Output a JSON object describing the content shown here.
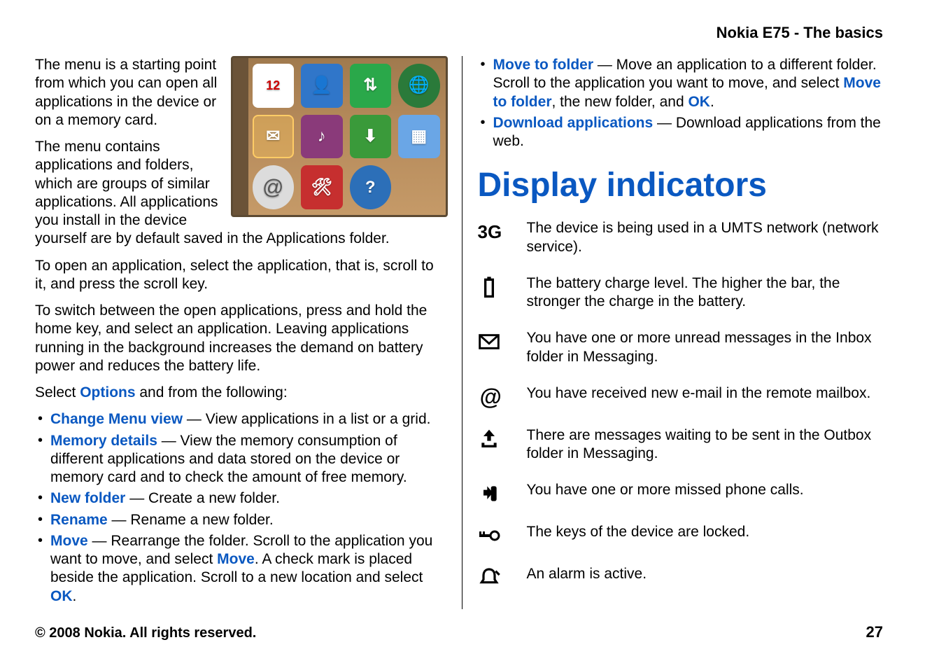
{
  "header": {
    "title": "Nokia E75 - The basics"
  },
  "left": {
    "p1": "The menu is a starting point from which you can open all applications in the device or on a memory card.",
    "p2": "The menu contains applications and folders, which are groups of similar applications. All applications you install in the device yourself are by default saved in the Applications folder.",
    "p3": "To open an application, select the application, that is, scroll to it, and press the scroll key.",
    "p4": "To switch between the open applications, press and hold the home key, and select an application. Leaving applications running in the background increases the demand on battery power and reduces the battery life.",
    "select_prefix": "Select ",
    "options_word": "Options",
    "select_suffix": " and from the following:",
    "opts": {
      "change_menu_view": {
        "label": "Change Menu view",
        "desc": " — View applications in a list or a grid."
      },
      "memory_details": {
        "label": "Memory details",
        "desc": " — View the memory consumption of different applications and data stored on the device or memory card and to check the amount of free memory."
      },
      "new_folder": {
        "label": "New folder",
        "desc": " — Create a new folder."
      },
      "rename": {
        "label": "Rename",
        "desc": " — Rename a new folder."
      },
      "move": {
        "label": "Move",
        "desc1": " — Rearrange the folder. Scroll to the application you want to move, and select ",
        "move_word": "Move",
        "desc2": ". A check mark is placed beside the application. Scroll to a new location and select ",
        "ok_word": "OK",
        "desc3": "."
      }
    },
    "menu_screenshot": {
      "calendar_day": "12"
    }
  },
  "right": {
    "opts": {
      "move_to_folder": {
        "label": "Move to folder",
        "desc1": " — Move an application to a different folder. Scroll to the application you want to move, and select ",
        "label2": "Move to folder",
        "desc2": ", the new folder, and ",
        "ok_word": "OK",
        "desc3": "."
      },
      "download_apps": {
        "label": "Download applications",
        "desc": " — Download applications from the web."
      }
    },
    "section_title": "Display indicators",
    "indicators": {
      "threeg": {
        "label": "3G",
        "desc": "The device is being used in a UMTS network (network service)."
      },
      "battery": {
        "desc": "The battery charge level. The higher the bar, the stronger the charge in the battery."
      },
      "inbox": {
        "desc": "You have one or more unread messages in the Inbox folder in Messaging."
      },
      "email": {
        "desc": "You have received new e-mail in the remote mailbox."
      },
      "outbox": {
        "desc": "There are messages waiting to be sent in the Outbox folder in Messaging."
      },
      "missed": {
        "desc": "You have one or more missed phone calls."
      },
      "locked": {
        "desc": "The keys of the device are locked."
      },
      "alarm": {
        "desc": "An alarm is active."
      }
    }
  },
  "footer": {
    "copyright": "© 2008 Nokia. All rights reserved.",
    "page": "27"
  }
}
